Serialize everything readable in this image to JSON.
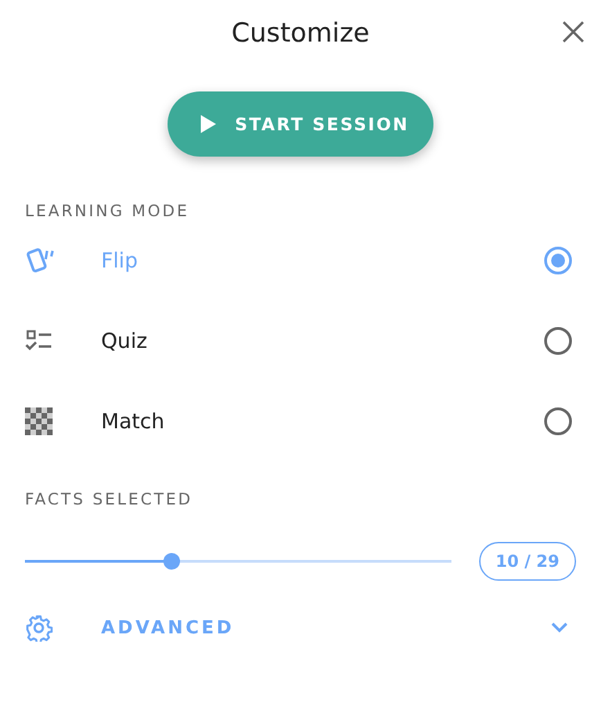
{
  "title": "Customize",
  "start_button": {
    "label": "START SESSION"
  },
  "learning_mode": {
    "heading": "LEARNING MODE",
    "options": [
      {
        "kind": "flip",
        "label": "Flip",
        "selected": true
      },
      {
        "kind": "quiz",
        "label": "Quiz",
        "selected": false
      },
      {
        "kind": "match",
        "label": "Match",
        "selected": false
      }
    ]
  },
  "facts": {
    "heading": "FACTS SELECTED",
    "level": 0.345,
    "count": "10 / 29"
  },
  "advanced": {
    "label": "ADVANCED",
    "expanded": false
  }
}
